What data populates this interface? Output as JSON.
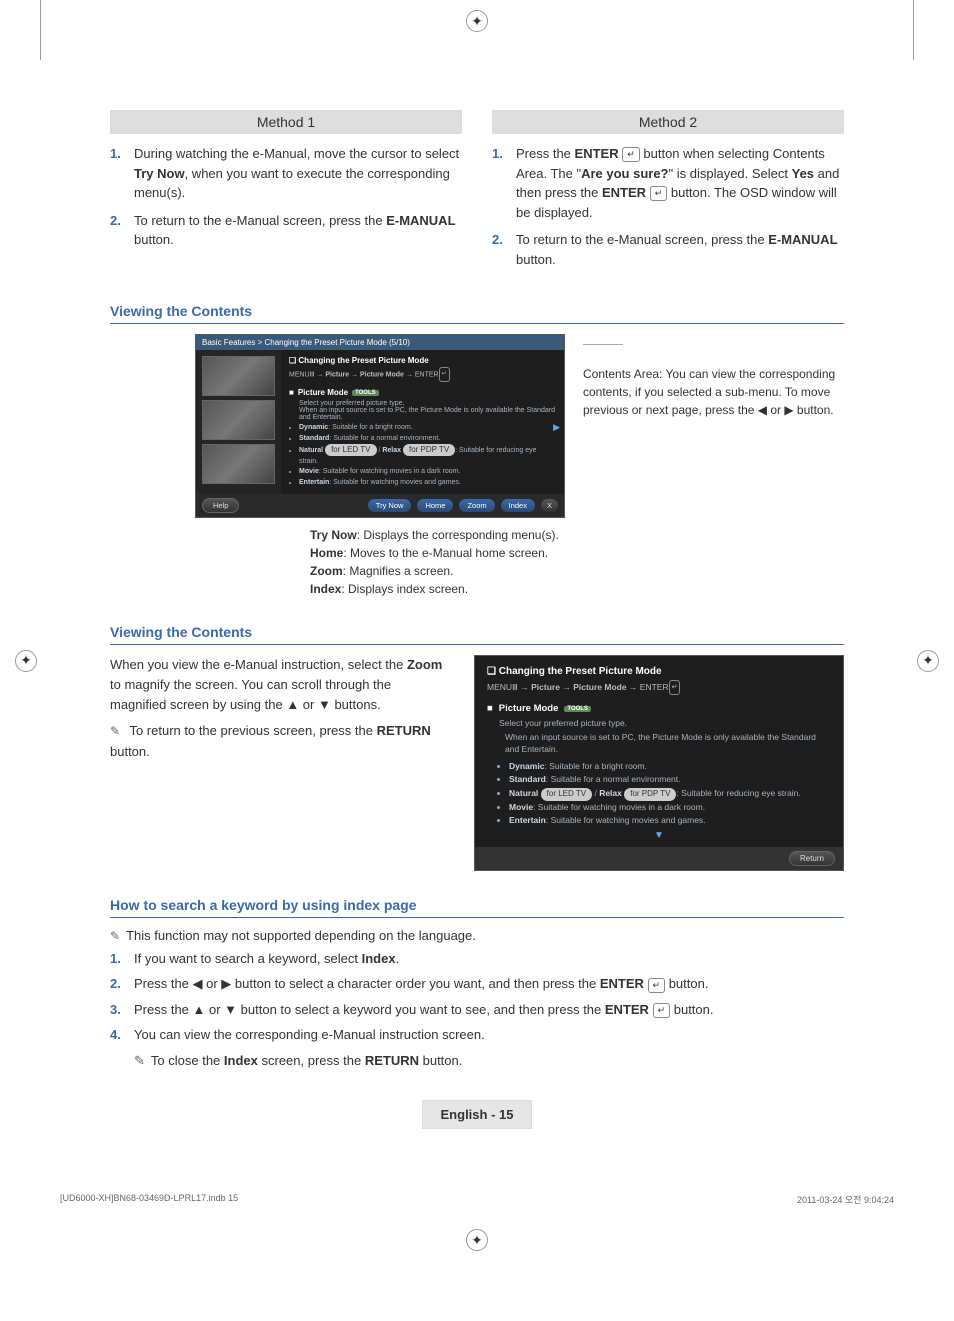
{
  "cropmark": "✦",
  "methods": {
    "method1": {
      "header": "Method 1",
      "step1_num": "1.",
      "step1_a": "During watching the e-Manual, move the cursor to select ",
      "step1_b": "Try Now",
      "step1_c": ", when you want to execute the corresponding menu(s).",
      "step2_num": "2.",
      "step2_a": "To return to the e-Manual screen, press the ",
      "step2_b": "E-MANUAL",
      "step2_c": " button."
    },
    "method2": {
      "header": "Method 2",
      "step1_num": "1.",
      "step1_a": "Press the ",
      "step1_b": "ENTER",
      "step1_icon": "↵",
      "step1_c": " button when selecting Contents Area. The \"",
      "step1_d": "Are you sure?",
      "step1_e": "\" is displayed. Select ",
      "step1_f": "Yes",
      "step1_g": " and then press the ",
      "step1_h": "ENTER",
      "step1_i": " button. The OSD window will be displayed.",
      "step2_num": "2.",
      "step2_a": "To return to the e-Manual screen, press the ",
      "step2_b": "E-MANUAL",
      "step2_c": " button."
    }
  },
  "section1_title": "Viewing the Contents",
  "ui1": {
    "breadcrumb": "Basic Features > Changing the Preset Picture Mode (5/10)",
    "contentTitle": "Changing the Preset Picture Mode",
    "path_a": "MENU",
    "path_arrow": " → ",
    "path_b": "Picture",
    "path_c": "Picture Mode",
    "path_d": "ENTER",
    "pm_label": "Picture Mode",
    "tools_tag": "TOOLS",
    "select_note": "Select your preferred picture type.",
    "pc_note": "When an input source is set to PC, the Picture Mode is only available the Standard and Entertain.",
    "items": {
      "dynamic_l": "Dynamic",
      "dynamic_t": ": Suitable for a bright room.",
      "standard_l": "Standard",
      "standard_t": ": Suitable for a normal environment.",
      "natural_l": "Natural",
      "relax_l": "Relax",
      "natural_t": ": Suitable for reducing eye strain.",
      "led_tag": "for LED TV",
      "pdp_tag": "for PDP TV",
      "movie_l": "Movie",
      "movie_t": ": Suitable for watching movies in a dark room.",
      "entertain_l": "Entertain",
      "entertain_t": ": Suitable for watching movies and games."
    },
    "help_btn": "Help",
    "trynow_btn": "Try Now",
    "home_btn": "Home",
    "zoom_btn": "Zoom",
    "index_btn": "Index",
    "x_btn": "X",
    "chev": "▶"
  },
  "captions": {
    "trynow_l": "Try Now",
    "trynow_t": ": Displays the corresponding menu(s).",
    "home_l": "Home",
    "home_t": ": Moves to the e-Manual home screen.",
    "zoom_l": "Zoom",
    "zoom_t": ": Magnifies a screen.",
    "index_l": "Index",
    "index_t": ": Displays index screen.",
    "contents_area": "Contents Area: You can view the corresponding contents, if you selected a sub-menu. To move previous or next page, press the ◀ or ▶ button."
  },
  "section2_title": "Viewing the Contents",
  "zoom_para_a": "When you view the e-Manual instruction, select the ",
  "zoom_para_b": "Zoom",
  "zoom_para_c": " to magnify the screen. You can scroll through the magnified screen by using the ▲ or ▼ buttons.",
  "zoom_note": "To return to the previous screen, press the ",
  "zoom_note_b": "RETURN",
  "zoom_note_c": " button.",
  "ui2": {
    "contentTitle": "Changing the Preset Picture Mode",
    "path_a": "MENU",
    "path_b": "Picture",
    "path_c": "Picture Mode",
    "path_d": "ENTER",
    "pm_label": "Picture Mode",
    "tools_tag": "TOOLS",
    "select_note": "Select your preferred picture type.",
    "pc_note": "When an input source is set to PC, the Picture Mode is only available the Standard and Entertain.",
    "return_btn": "Return",
    "arrow_down": "▼"
  },
  "section3_title": "How to search a keyword by using index page",
  "howto": {
    "note": "This function may not supported depending on the language.",
    "s1_num": "1.",
    "s1_a": "If you want to search a keyword, select ",
    "s1_b": "Index",
    "s1_c": ".",
    "s2_num": "2.",
    "s2_a": "Press the ◀ or ▶ button to select a character order you want, and then press the ",
    "s2_b": "ENTER",
    "s2_c": " button.",
    "s3_num": "3.",
    "s3_a": "Press the ▲ or ▼ button to select a keyword you want to see, and then press the ",
    "s3_b": "ENTER",
    "s3_c": " button.",
    "s4_num": "4.",
    "s4_a": "You can view the corresponding e-Manual instruction screen.",
    "close_note_a": "To close the ",
    "close_note_b": "Index",
    "close_note_c": " screen, press the ",
    "close_note_d": "RETURN",
    "close_note_e": " button."
  },
  "enter_icon": "↵",
  "page_num": "English - 15",
  "indd_left": "[UD6000-XH]BN68-03469D-LPRL17.indb   15",
  "indd_right": "2011-03-24   오전 9:04:24"
}
